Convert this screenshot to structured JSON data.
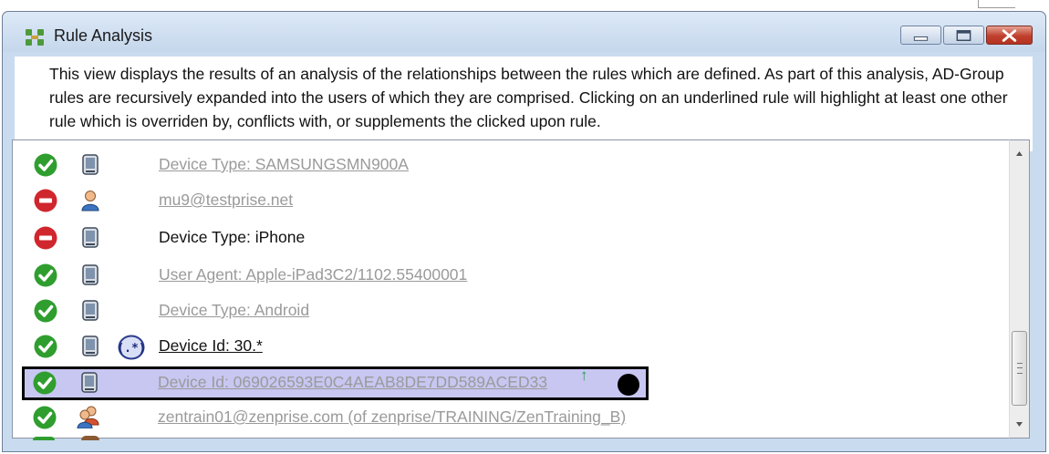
{
  "window": {
    "title": "Rule Analysis"
  },
  "description": "This view displays the results of an analysis of the relationships between the rules which are defined. As part of this analysis, AD-Group rules are recursively expanded into the users of which they are comprised. Clicking on an underlined rule will highlight at least one other rule which is overriden by, conflicts with, or supplements the clicked upon rule.",
  "rules": [
    {
      "status": "allow-check-icon",
      "type": "device-icon",
      "label": "Device Type: SAMSUNGSMN900A",
      "style": "gray"
    },
    {
      "status": "deny-icon",
      "type": "user-icon",
      "label": "mu9@testprise.net",
      "style": "gray"
    },
    {
      "status": "deny-icon",
      "type": "device-icon",
      "label": "Device Type: iPhone",
      "style": "black"
    },
    {
      "status": "allow-check-icon",
      "type": "device-icon",
      "label": "User Agent: Apple-iPad3C2/1102.55400001",
      "style": "gray"
    },
    {
      "status": "allow-check-icon",
      "type": "device-icon",
      "label": "Device Type: Android",
      "style": "gray"
    },
    {
      "status": "allow-check-icon",
      "type": "device-icon",
      "regex": "(.*)",
      "label": "Device Id: 30.*",
      "style": "black-underlined"
    },
    {
      "status": "allow-check-icon",
      "type": "device-icon",
      "label": "Device Id: 069026593E0C4AEAB8DE7DD589ACED33",
      "style": "gray",
      "selected": true,
      "marker": "↑"
    },
    {
      "status": "allow-check-icon",
      "type": "group-icon",
      "label": "zentrain01@zenprise.com (of zenprise/TRAINING/ZenTraining_B)",
      "style": "gray"
    }
  ],
  "colors": {
    "allow": "#2f9e2f",
    "deny": "#d0262d",
    "selection": "#c8c7f2",
    "muted_text": "#9a9a9a"
  }
}
